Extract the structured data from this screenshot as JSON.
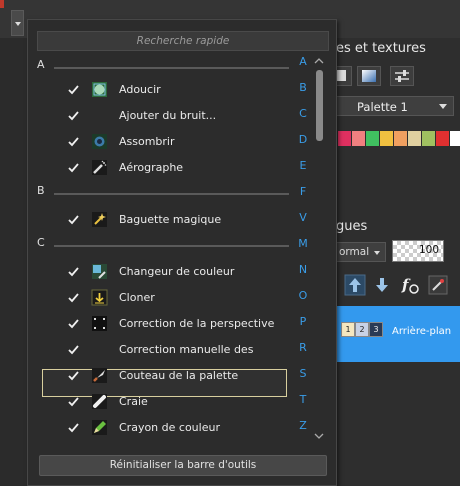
{
  "search": {
    "placeholder": "Recherche rapide"
  },
  "groups": [
    {
      "letter": "A"
    },
    {
      "letter": "B"
    },
    {
      "letter": "C"
    }
  ],
  "items": [
    {
      "label": "Adoucir",
      "checked": true,
      "icon": "soften-icon"
    },
    {
      "label": "Ajouter du bruit...",
      "checked": true,
      "icon": "none"
    },
    {
      "label": "Assombrir",
      "checked": true,
      "icon": "darken-icon"
    },
    {
      "label": "Aérographe",
      "checked": true,
      "icon": "airbrush-icon"
    },
    {
      "label": "Baguette magique",
      "checked": true,
      "icon": "magic-wand-icon"
    },
    {
      "label": "Changeur de couleur",
      "checked": true,
      "icon": "color-changer-icon"
    },
    {
      "label": "Cloner",
      "checked": true,
      "icon": "clone-icon"
    },
    {
      "label": "Correction de la perspective",
      "checked": true,
      "icon": "perspective-icon"
    },
    {
      "label": "Correction manuelle des",
      "checked": true,
      "icon": "none",
      "highlighted": true
    },
    {
      "label": "Couteau de la palette",
      "checked": true,
      "icon": "palette-knife-icon"
    },
    {
      "label": "Craie",
      "checked": true,
      "icon": "chalk-icon"
    },
    {
      "label": "Crayon de couleur",
      "checked": true,
      "icon": "colored-pencil-icon"
    }
  ],
  "alpha_index": [
    "A",
    "B",
    "C",
    "D",
    "E",
    "F",
    "V",
    "M",
    "N",
    "O",
    "P",
    "R",
    "S",
    "T",
    "Z"
  ],
  "reset_button": {
    "label": "Réinitialiser la barre d'outils"
  },
  "background": {
    "panel_title": "es et textures",
    "palette_select": "Palette 1",
    "layers_title": "gues",
    "blend_mode": "ormal",
    "opacity": "100",
    "layer_name": "Arrière-plan",
    "layer_thumb_labels": [
      "1",
      "2",
      "3"
    ],
    "swatch_colors": [
      "#e03060",
      "#f08080",
      "#40c060",
      "#f0c040",
      "#f0a060",
      "#e0d0a0",
      "#a0c060",
      "#e03030",
      "#ffffff",
      "#d0d0d0"
    ]
  },
  "colors": {
    "accent_blue": "#3399ee",
    "highlight_border": "#d8cf9e",
    "index_blue": "#3a9de8"
  }
}
